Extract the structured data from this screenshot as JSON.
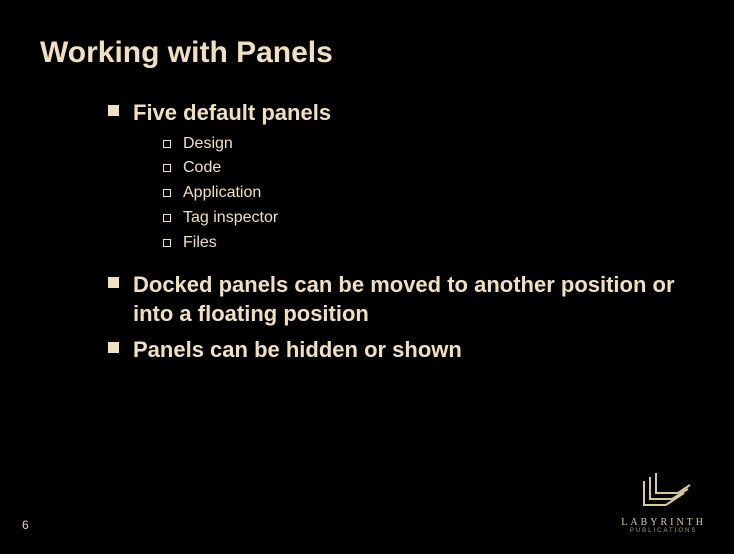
{
  "slide": {
    "title": "Working with Panels",
    "bullets": [
      {
        "text": "Five default panels",
        "sub": [
          "Design",
          "Code",
          "Application",
          "Tag inspector",
          "Files"
        ]
      },
      {
        "text": "Docked panels can be moved to another position or into a floating position",
        "sub": []
      },
      {
        "text": "Panels can be hidden or shown",
        "sub": []
      }
    ]
  },
  "page_number": "6",
  "logo": {
    "name": "LABYRINTH",
    "tagline": "PUBLICATIONS"
  }
}
